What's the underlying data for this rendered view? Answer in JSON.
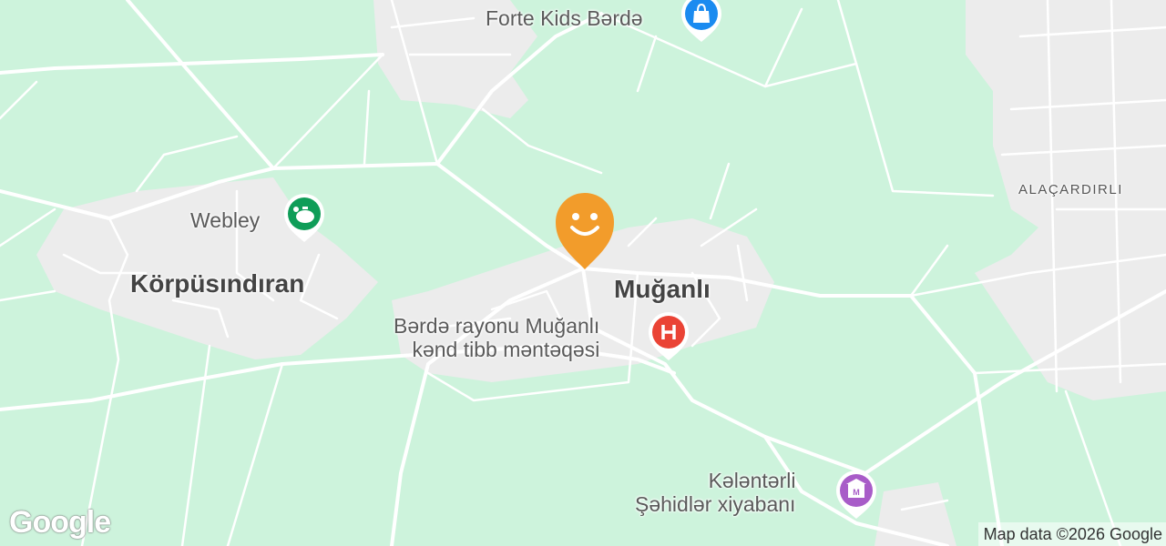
{
  "map": {
    "colors": {
      "land": "#cdf3dc",
      "road": "#ffffff",
      "built": "#ececec"
    }
  },
  "places": {
    "muganli": "Muğanlı",
    "korpusindiran": "Körpüsındıran",
    "alacardirli": "ALAÇARDIRLI"
  },
  "pois": {
    "forte_kids": {
      "name": "Forte Kids Bərdə",
      "icon": "shopping-bag-icon",
      "color": "#1a8bf0"
    },
    "webley": {
      "name": "Webley",
      "icon": "piggy-bank-icon",
      "color": "#0f9d58"
    },
    "hospital": {
      "line1": "Bərdə rayonu Muğanlı",
      "line2": "kənd tibb məntəqəsi",
      "icon": "hospital-h-icon",
      "color": "#ea4335"
    },
    "kalantarli": {
      "line1": "Kələntərli",
      "line2": "Şəhidlər xiyabanı",
      "icon": "monument-icon",
      "color": "#a85cc8"
    },
    "smiley": {
      "icon": "smiley-pin-icon",
      "color": "#f29c2b"
    }
  },
  "footer": {
    "logo": "Google",
    "attribution": "Map data ©2026 Google"
  }
}
